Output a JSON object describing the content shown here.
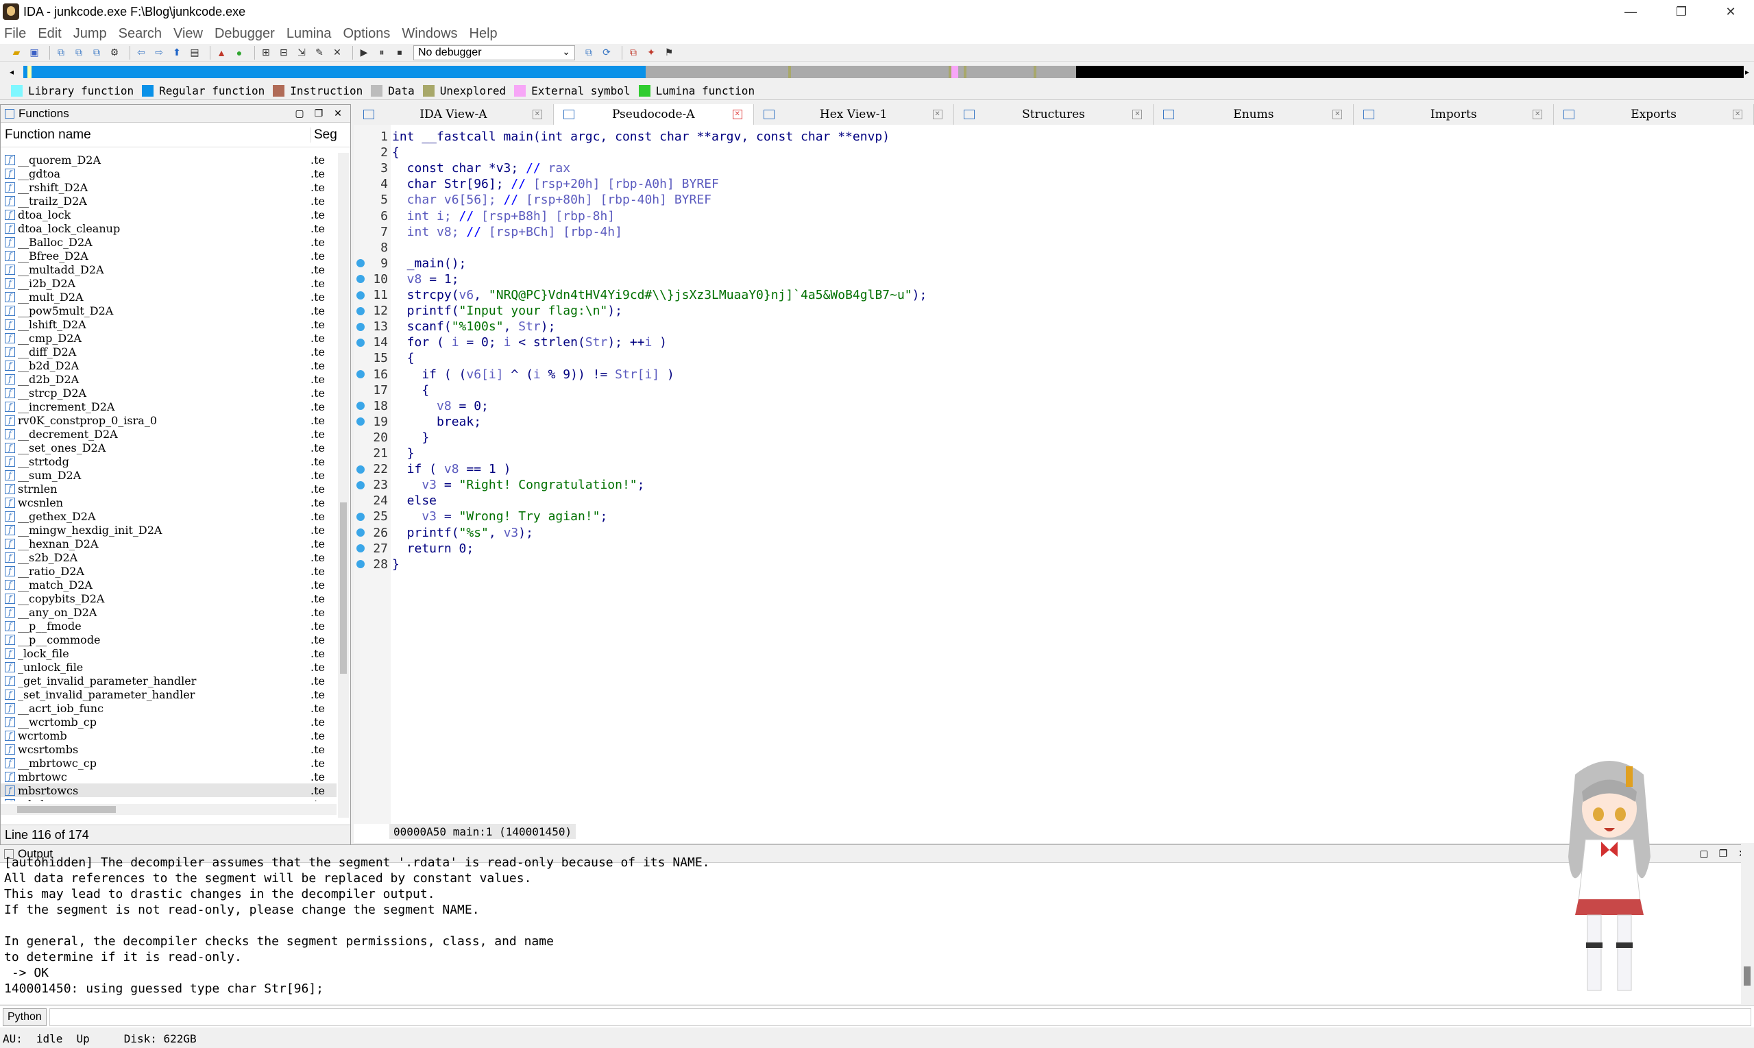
{
  "window": {
    "title": "IDA - junkcode.exe F:\\Blog\\junkcode.exe",
    "minimize": "—",
    "maximize": "❐",
    "close": "✕"
  },
  "menu": [
    "File",
    "Edit",
    "Jump",
    "Search",
    "View",
    "Debugger",
    "Lumina",
    "Options",
    "Windows",
    "Help"
  ],
  "toolbar": {
    "debugger_select": "No debugger"
  },
  "legend": [
    {
      "label": "Library function",
      "color": "#7ff7ff"
    },
    {
      "label": "Regular function",
      "color": "#0a91e8"
    },
    {
      "label": "Instruction",
      "color": "#b06b57"
    },
    {
      "label": "Data",
      "color": "#bcbcbc"
    },
    {
      "label": "Unexplored",
      "color": "#a8a86a"
    },
    {
      "label": "External symbol",
      "color": "#f7a6f7"
    },
    {
      "label": "Lumina function",
      "color": "#2fcc2f"
    }
  ],
  "functions": {
    "title": "Functions",
    "col_name": "Function name",
    "col_seg": "Seg",
    "status": "Line 116 of 174",
    "items": [
      {
        "name": "__quorem_D2A",
        "seg": ".te"
      },
      {
        "name": "__gdtoa",
        "seg": ".te"
      },
      {
        "name": "__rshift_D2A",
        "seg": ".te"
      },
      {
        "name": "__trailz_D2A",
        "seg": ".te"
      },
      {
        "name": "dtoa_lock",
        "seg": ".te"
      },
      {
        "name": "dtoa_lock_cleanup",
        "seg": ".te"
      },
      {
        "name": "__Balloc_D2A",
        "seg": ".te"
      },
      {
        "name": "__Bfree_D2A",
        "seg": ".te"
      },
      {
        "name": "__multadd_D2A",
        "seg": ".te"
      },
      {
        "name": "__i2b_D2A",
        "seg": ".te"
      },
      {
        "name": "__mult_D2A",
        "seg": ".te"
      },
      {
        "name": "__pow5mult_D2A",
        "seg": ".te"
      },
      {
        "name": "__lshift_D2A",
        "seg": ".te"
      },
      {
        "name": "__cmp_D2A",
        "seg": ".te"
      },
      {
        "name": "__diff_D2A",
        "seg": ".te"
      },
      {
        "name": "__b2d_D2A",
        "seg": ".te"
      },
      {
        "name": "__d2b_D2A",
        "seg": ".te"
      },
      {
        "name": "__strcp_D2A",
        "seg": ".te"
      },
      {
        "name": "__increment_D2A",
        "seg": ".te"
      },
      {
        "name": "rv0K_constprop_0_isra_0",
        "seg": ".te"
      },
      {
        "name": "__decrement_D2A",
        "seg": ".te"
      },
      {
        "name": "__set_ones_D2A",
        "seg": ".te"
      },
      {
        "name": "__strtodg",
        "seg": ".te"
      },
      {
        "name": "__sum_D2A",
        "seg": ".te"
      },
      {
        "name": "strnlen",
        "seg": ".te"
      },
      {
        "name": "wcsnlen",
        "seg": ".te"
      },
      {
        "name": "__gethex_D2A",
        "seg": ".te"
      },
      {
        "name": "__mingw_hexdig_init_D2A",
        "seg": ".te"
      },
      {
        "name": "__hexnan_D2A",
        "seg": ".te"
      },
      {
        "name": "__s2b_D2A",
        "seg": ".te"
      },
      {
        "name": "__ratio_D2A",
        "seg": ".te"
      },
      {
        "name": "__match_D2A",
        "seg": ".te"
      },
      {
        "name": "__copybits_D2A",
        "seg": ".te"
      },
      {
        "name": "__any_on_D2A",
        "seg": ".te"
      },
      {
        "name": "__p__fmode",
        "seg": ".te"
      },
      {
        "name": "__p__commode",
        "seg": ".te"
      },
      {
        "name": "_lock_file",
        "seg": ".te"
      },
      {
        "name": "_unlock_file",
        "seg": ".te"
      },
      {
        "name": "_get_invalid_parameter_handler",
        "seg": ".te"
      },
      {
        "name": "_set_invalid_parameter_handler",
        "seg": ".te"
      },
      {
        "name": "__acrt_iob_func",
        "seg": ".te"
      },
      {
        "name": "__wcrtomb_cp",
        "seg": ".te"
      },
      {
        "name": "wcrtomb",
        "seg": ".te"
      },
      {
        "name": "wcsrtombs",
        "seg": ".te"
      },
      {
        "name": "__mbrtowc_cp",
        "seg": ".te"
      },
      {
        "name": "mbrtowc",
        "seg": ".te"
      },
      {
        "name": "mbsrtowcs",
        "seg": ".te"
      },
      {
        "name": "mbrlen",
        "seg": ".te"
      }
    ]
  },
  "tabs": [
    {
      "label": "IDA View-A",
      "active": false
    },
    {
      "label": "Pseudocode-A",
      "active": true
    },
    {
      "label": "Hex View-1",
      "active": false
    },
    {
      "label": "Structures",
      "active": false
    },
    {
      "label": "Enums",
      "active": false
    },
    {
      "label": "Imports",
      "active": false
    },
    {
      "label": "Exports",
      "active": false
    }
  ],
  "code": {
    "lines": [
      {
        "n": "1",
        "bp": false,
        "html": "<span class=\"kw\">int __fastcall main(int argc, const char **argv, const char **envp)</span>"
      },
      {
        "n": "2",
        "bp": false,
        "html": "<span class=\"kw\">{</span>"
      },
      {
        "n": "3",
        "bp": false,
        "html": "<span class=\"kw\">  const char *v3; </span><span class=\"cm\">// </span><span class=\"vr\">rax</span>"
      },
      {
        "n": "4",
        "bp": false,
        "html": "<span class=\"kw\">  char Str[96]; </span><span class=\"cm\">// </span><span class=\"vr\">[rsp+20h] [rbp-A0h] BYREF</span>"
      },
      {
        "n": "5",
        "bp": false,
        "html": "<span class=\"vr\">  char v6[56]; </span><span class=\"cm\">// </span><span class=\"vr\">[rsp+80h] [rbp-40h] BYREF</span>"
      },
      {
        "n": "6",
        "bp": false,
        "html": "<span class=\"vr\">  int i; </span><span class=\"cm\">// </span><span class=\"vr\">[rsp+B8h] [rbp-8h]</span>"
      },
      {
        "n": "7",
        "bp": false,
        "html": "<span class=\"vr\">  int v8; </span><span class=\"cm\">// </span><span class=\"vr\">[rsp+BCh] [rbp-4h]</span>"
      },
      {
        "n": "8",
        "bp": false,
        "html": ""
      },
      {
        "n": "9",
        "bp": true,
        "html": "<span class=\"kw\">  _main();</span>"
      },
      {
        "n": "10",
        "bp": true,
        "html": "<span class=\"vr\">  v8</span><span class=\"kw\"> = 1;</span>"
      },
      {
        "n": "11",
        "bp": true,
        "html": "<span class=\"kw\">  strcpy(</span><span class=\"vr\">v6</span><span class=\"kw\">, </span><span class=\"st\">\"NRQ@PC}Vdn4tHV4Yi9cd#\\\\}jsXz3LMuaaY0}nj]`4a5&amp;WoB4glB7~u\"</span><span class=\"kw\">);</span>"
      },
      {
        "n": "12",
        "bp": true,
        "html": "<span class=\"kw\">  printf(</span><span class=\"st\">\"Input your flag:\\n\"</span><span class=\"kw\">);</span>"
      },
      {
        "n": "13",
        "bp": true,
        "html": "<span class=\"kw\">  scanf(</span><span class=\"st\">\"%100s\"</span><span class=\"kw\">, </span><span class=\"vr\">Str</span><span class=\"kw\">);</span>"
      },
      {
        "n": "14",
        "bp": true,
        "html": "<span class=\"kw\">  for ( </span><span class=\"vr\">i</span><span class=\"kw\"> = 0; </span><span class=\"vr\">i</span><span class=\"kw\"> &lt; strlen(</span><span class=\"vr\">Str</span><span class=\"kw\">); ++</span><span class=\"vr\">i</span><span class=\"kw\"> )</span>"
      },
      {
        "n": "15",
        "bp": false,
        "html": "<span class=\"kw\">  {</span>"
      },
      {
        "n": "16",
        "bp": true,
        "html": "<span class=\"kw\">    if ( (</span><span class=\"vr\">v6[i]</span><span class=\"kw\"> ^ (</span><span class=\"vr\">i</span><span class=\"kw\"> % 9)) != </span><span class=\"vr\">Str[i]</span><span class=\"kw\"> )</span>"
      },
      {
        "n": "17",
        "bp": false,
        "html": "<span class=\"kw\">    {</span>"
      },
      {
        "n": "18",
        "bp": true,
        "html": "<span class=\"vr\">      v8</span><span class=\"kw\"> = 0;</span>"
      },
      {
        "n": "19",
        "bp": true,
        "html": "<span class=\"kw\">      break;</span>"
      },
      {
        "n": "20",
        "bp": false,
        "html": "<span class=\"kw\">    }</span>"
      },
      {
        "n": "21",
        "bp": false,
        "html": "<span class=\"kw\">  }</span>"
      },
      {
        "n": "22",
        "bp": true,
        "html": "<span class=\"kw\">  if ( </span><span class=\"vr\">v8</span><span class=\"kw\"> == 1 )</span>"
      },
      {
        "n": "23",
        "bp": true,
        "html": "<span class=\"vr\">    v3</span><span class=\"kw\"> = </span><span class=\"st\">\"Right! Congratulation!\"</span><span class=\"kw\">;</span>"
      },
      {
        "n": "24",
        "bp": false,
        "html": "<span class=\"kw\">  else</span>"
      },
      {
        "n": "25",
        "bp": true,
        "html": "<span class=\"vr\">    v3</span><span class=\"kw\"> = </span><span class=\"st\">\"Wrong! Try agian!\"</span><span class=\"kw\">;</span>"
      },
      {
        "n": "26",
        "bp": true,
        "html": "<span class=\"kw\">  printf(</span><span class=\"st\">\"%s\"</span><span class=\"kw\">, </span><span class=\"vr\">v3</span><span class=\"kw\">);</span>"
      },
      {
        "n": "27",
        "bp": true,
        "html": "<span class=\"kw\">  return 0;</span>"
      },
      {
        "n": "28",
        "bp": true,
        "html": "<span class=\"kw\">}</span>"
      }
    ],
    "status": "00000A50 main:1 (140001450)"
  },
  "output": {
    "title": "Output",
    "lines": [
      "[autohidden] The decompiler assumes that the segment '.rdata' is read-only because of its NAME.",
      "All data references to the segment will be replaced by constant values.",
      "This may lead to drastic changes in the decompiler output.",
      "If the segment is not read-only, please change the segment NAME.",
      "",
      "In general, the decompiler checks the segment permissions, class, and name",
      "to determine if it is read-only.",
      " -> OK",
      "140001450: using guessed type char Str[96];"
    ]
  },
  "python": {
    "label": "Python"
  },
  "statusbar": {
    "au": "AU:",
    "state": "idle",
    "dir": "Up",
    "disk": "Disk: 622GB"
  }
}
